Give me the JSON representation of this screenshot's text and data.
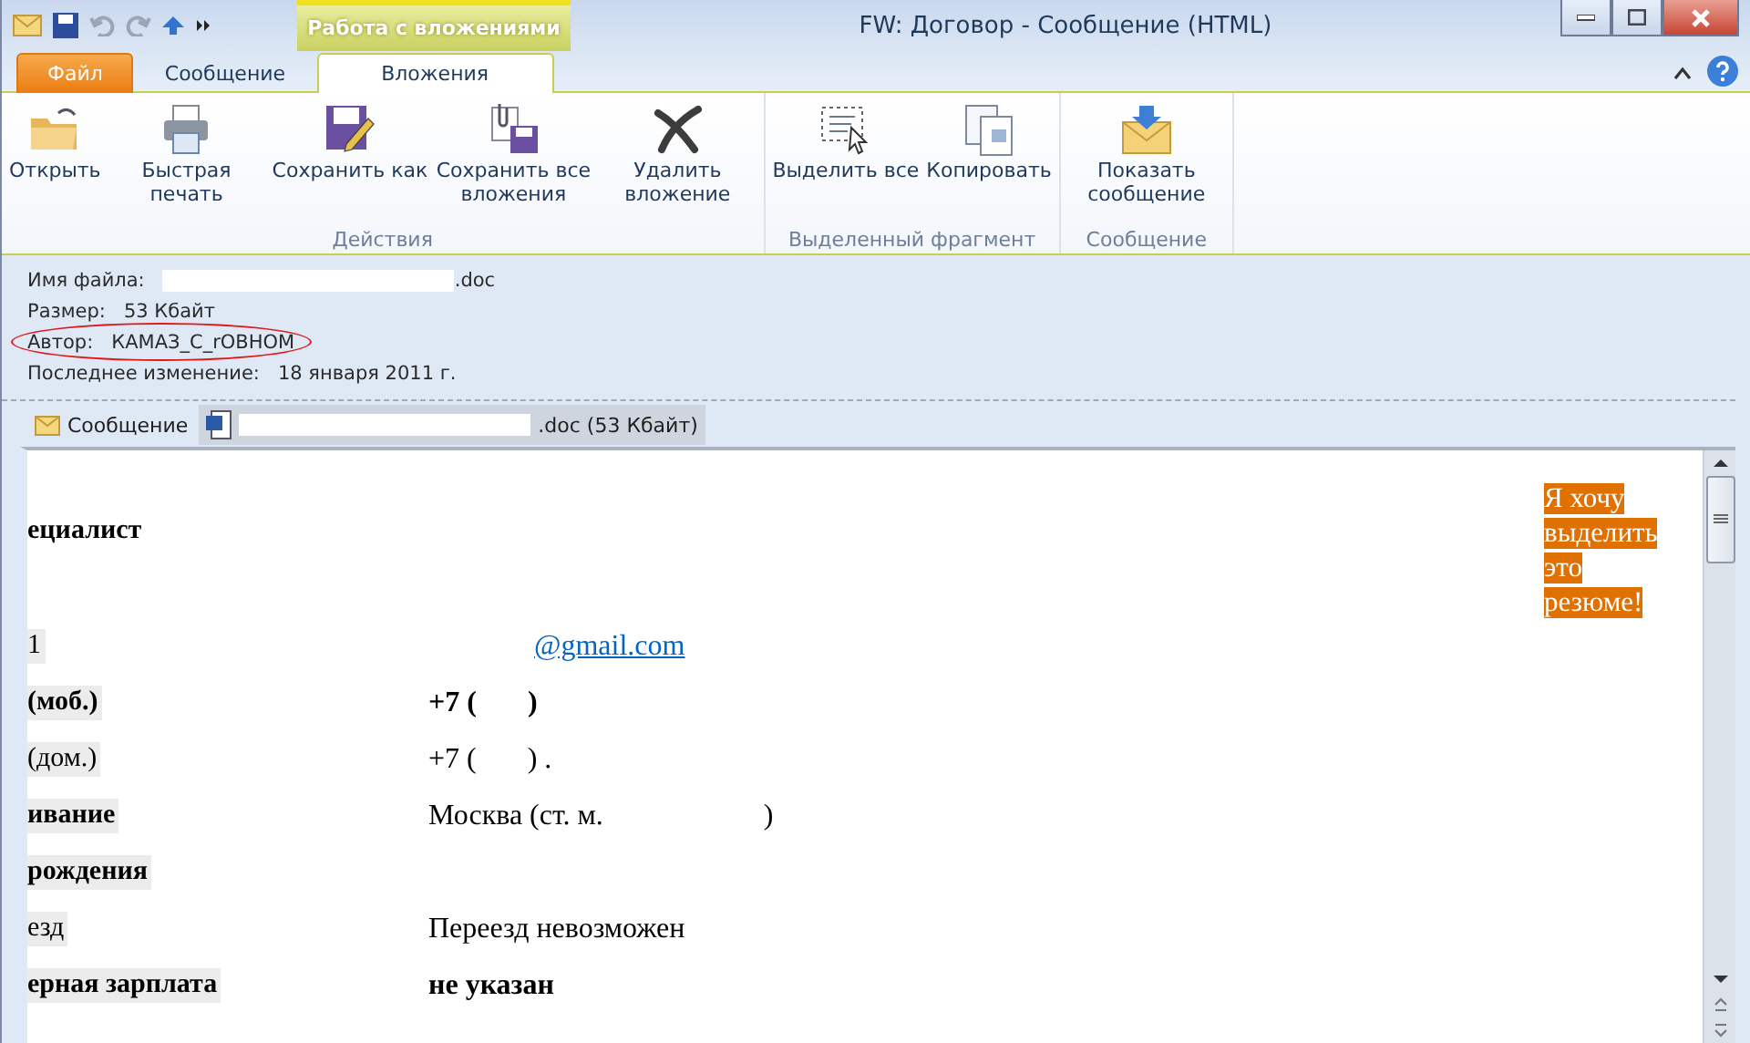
{
  "window": {
    "contextual_tab": "Работа с вложениями",
    "title": "FW: Договор  -  Сообщение (HTML)"
  },
  "tabs": [
    {
      "label": "Файл",
      "kind": "file",
      "selected": false
    },
    {
      "label": "Сообщение",
      "kind": "normal",
      "selected": false
    },
    {
      "label": "Вложения",
      "kind": "normal",
      "selected": true
    }
  ],
  "ribbon_groups": [
    {
      "label": "Действия",
      "buttons": [
        {
          "label": "Открыть",
          "kind": "open"
        },
        {
          "label": "Быстрая печать",
          "kind": "print"
        },
        {
          "label": "Сохранить как",
          "kind": "saveas"
        },
        {
          "label": "Сохранить все вложения",
          "kind": "saveall"
        },
        {
          "label": "Удалить вложение",
          "kind": "delete"
        }
      ]
    },
    {
      "label": "Выделенный фрагмент",
      "buttons": [
        {
          "label": "Выделить все",
          "kind": "select"
        },
        {
          "label": "Копировать",
          "kind": "copy"
        }
      ]
    },
    {
      "label": "Сообщение",
      "buttons": [
        {
          "label": "Показать сообщение",
          "kind": "show"
        }
      ]
    }
  ],
  "file_info": [
    {
      "label": "Имя файла:",
      "value": ".doc",
      "redacted": true,
      "circled": false
    },
    {
      "label": "Размер:",
      "value": "53 Кбайт",
      "redacted": false,
      "circled": false
    },
    {
      "label": "Автор:",
      "value": "КАМАЗ_С_rОВНОМ",
      "redacted": false,
      "circled": true
    },
    {
      "label": "Последнее изменение:",
      "value": "18 января 2011 г.",
      "redacted": false,
      "circled": false
    }
  ],
  "attachment_tabs": [
    {
      "label": "Сообщение",
      "kind": "message",
      "redacted": false,
      "selected": false
    },
    {
      "label": ".doc (53 Кбайт)",
      "kind": "word",
      "redacted": true,
      "selected": true
    }
  ],
  "document": {
    "heading": "ециалист",
    "note": "Я хочу выделить это резюме!",
    "rows": [
      {
        "label": "1",
        "label_bold": false,
        "value": "@gmail.com",
        "kind": "link",
        "value_bold": false
      },
      {
        "label": "(моб.)",
        "label_bold": true,
        "value": "+7 (       )",
        "kind": "text",
        "value_bold": true
      },
      {
        "label": "(дом.)",
        "label_bold": false,
        "value": "+7 (       ) .",
        "kind": "text",
        "value_bold": false
      },
      {
        "label": "ивание",
        "label_bold": true,
        "value": "Москва (ст. м.                      )",
        "kind": "text",
        "value_bold": false
      },
      {
        "label": "рождения",
        "label_bold": true,
        "kind": "empty"
      },
      {
        "label": "езд",
        "label_bold": false,
        "value": "Переезд невозможен",
        "kind": "text",
        "value_bold": false
      },
      {
        "label": "ерная зарплата",
        "label_bold": true,
        "value": "не указан",
        "kind": "text",
        "value_bold": true
      }
    ]
  }
}
